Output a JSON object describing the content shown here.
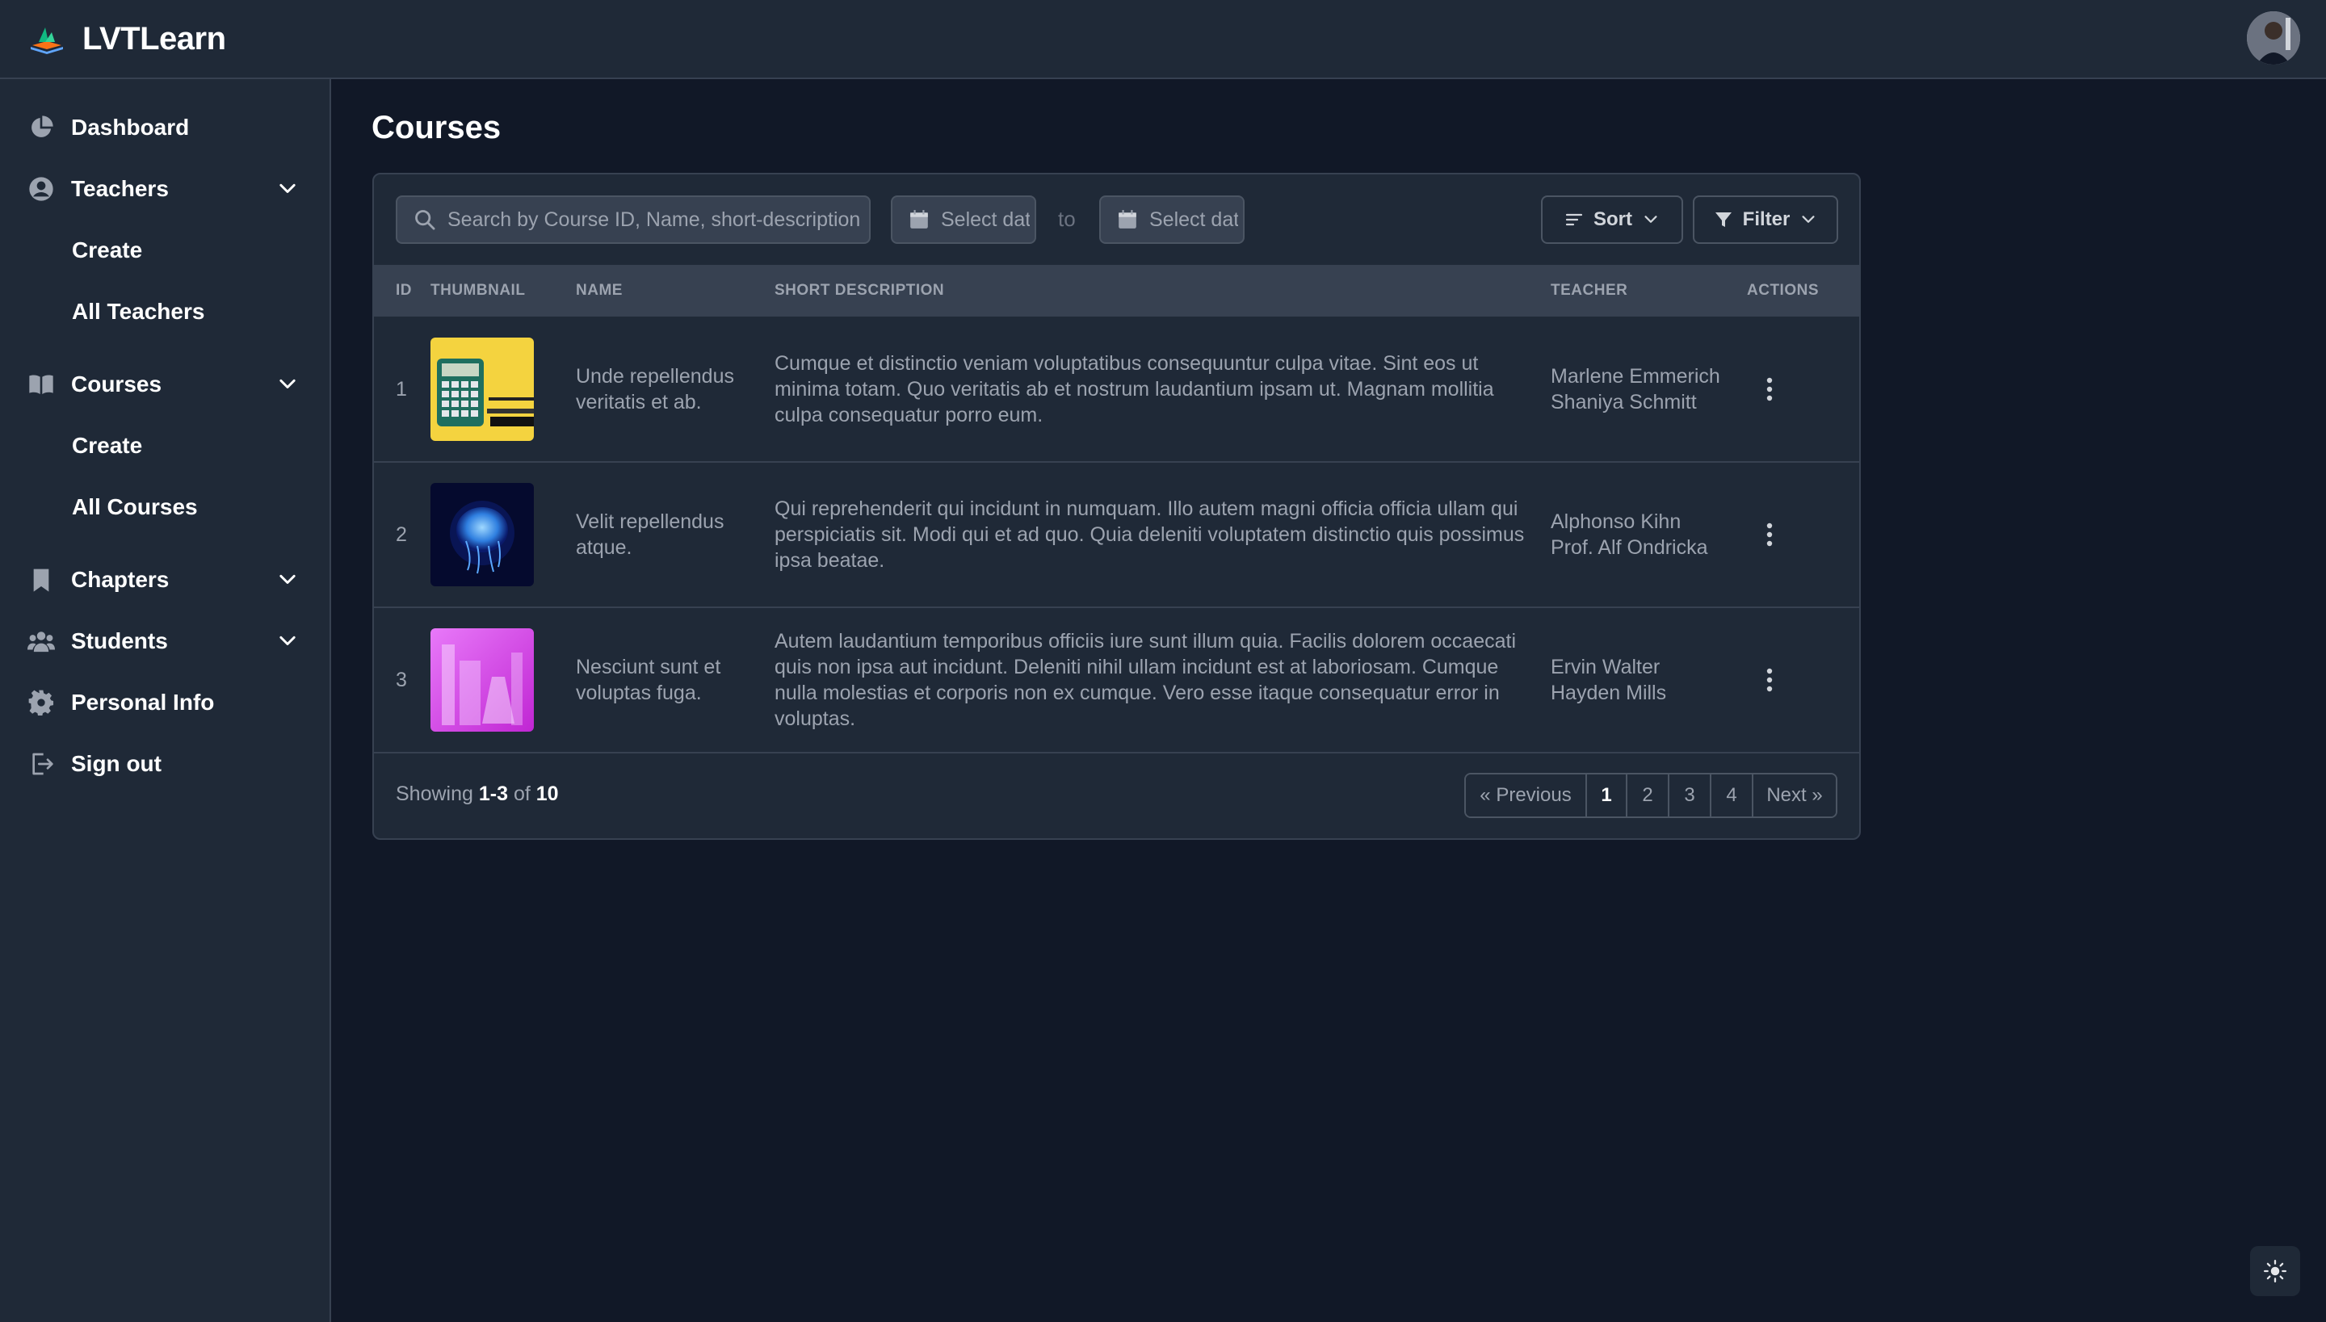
{
  "app": {
    "name": "LVTLearn"
  },
  "sidebar": {
    "items": [
      {
        "label": "Dashboard",
        "icon": "pie-chart-icon"
      },
      {
        "label": "Teachers",
        "icon": "user-circle-icon",
        "sub": [
          "Create",
          "All Teachers"
        ]
      },
      {
        "label": "Courses",
        "icon": "book-open-icon",
        "sub": [
          "Create",
          "All Courses"
        ]
      },
      {
        "label": "Chapters",
        "icon": "bookmark-icon"
      },
      {
        "label": "Students",
        "icon": "users-icon"
      },
      {
        "label": "Personal Info",
        "icon": "gear-icon"
      },
      {
        "label": "Sign out",
        "icon": "sign-out-icon"
      }
    ]
  },
  "main": {
    "title": "Courses",
    "search_placeholder": "Search by Course ID, Name, short-description",
    "date_from_placeholder": "Select date",
    "date_to_placeholder": "Select date",
    "to_label": "to",
    "sort_label": "Sort",
    "filter_label": "Filter",
    "columns": [
      "ID",
      "THUMBNAIL",
      "NAME",
      "SHORT DESCRIPTION",
      "TEACHER",
      "ACTIONS"
    ],
    "rows": [
      {
        "id": "1",
        "thumbnail": "calculator-thumbnail",
        "name": "Unde repellendus veritatis et ab.",
        "description": "Cumque et distinctio veniam voluptatibus consequuntur culpa vitae. Sint eos ut minima totam. Quo veritatis ab et nostrum laudantium ipsam ut. Magnam mollitia culpa consequatur porro eum.",
        "teachers": [
          "Marlene Emmerich",
          "Shaniya Schmitt"
        ]
      },
      {
        "id": "2",
        "thumbnail": "jellyfish-thumbnail",
        "name": "Velit repellendus atque.",
        "description": "Qui reprehenderit qui incidunt in numquam. Illo autem magni officia officia ullam qui perspiciatis sit. Modi qui et ad quo. Quia deleniti voluptatem distinctio quis possimus ipsa beatae.",
        "teachers": [
          "Alphonso Kihn",
          "Prof. Alf Ondricka"
        ]
      },
      {
        "id": "3",
        "thumbnail": "lab-glassware-thumbnail",
        "name": "Nesciunt sunt et voluptas fuga.",
        "description": "Autem laudantium temporibus officiis iure sunt illum quia. Facilis dolorem occaecati quis non ipsa aut incidunt. Deleniti nihil ullam incidunt est at laboriosam. Cumque nulla molestias et corporis non ex cumque. Vero esse itaque consequatur error in voluptas.",
        "teachers": [
          "Ervin Walter",
          "Hayden Mills"
        ]
      }
    ],
    "showing": {
      "prefix": "Showing",
      "range": "1-3",
      "of": "of",
      "total": "10"
    },
    "pagination": {
      "prev": "« Previous",
      "pages": [
        "1",
        "2",
        "3",
        "4"
      ],
      "next": "Next »",
      "current": "1"
    }
  },
  "colors": {
    "bg": "#111827",
    "panel": "#1f2937",
    "border": "#374151",
    "accent": "#2563eb"
  }
}
